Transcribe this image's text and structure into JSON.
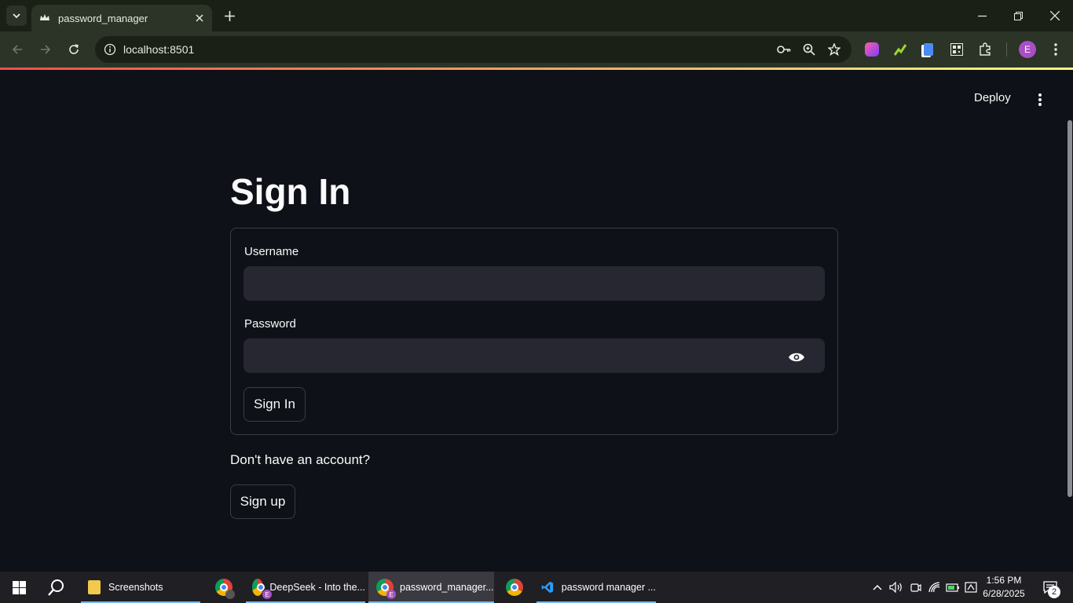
{
  "browser": {
    "tab_title": "password_manager",
    "url": "localhost:8501",
    "profile_initial": "E"
  },
  "app": {
    "deploy_label": "Deploy",
    "page_title": "Sign In",
    "form": {
      "username_label": "Username",
      "username_value": "",
      "password_label": "Password",
      "password_value": "",
      "submit_label": "Sign In"
    },
    "signup_prompt": "Don't have an account?",
    "signup_label": "Sign up"
  },
  "taskbar": {
    "items": [
      {
        "label": "Screenshots",
        "icon": "folder-icon"
      },
      {
        "label": "",
        "icon": "chrome-icon"
      },
      {
        "label": "DeepSeek - Into the...",
        "icon": "chrome-icon"
      },
      {
        "label": "password_manager...",
        "icon": "chrome-icon"
      },
      {
        "label": "",
        "icon": "chrome-icon"
      },
      {
        "label": "password manager ...",
        "icon": "vscode-icon"
      }
    ],
    "time": "1:56 PM",
    "date": "6/28/2025",
    "notification_count": "2",
    "profile_badge": "E"
  },
  "colors": {
    "background": "#0e1117",
    "input_bg": "#262730",
    "accent_start": "#ff4b4b",
    "accent_end": "#fffd80",
    "browser_frame": "#2b3426"
  }
}
